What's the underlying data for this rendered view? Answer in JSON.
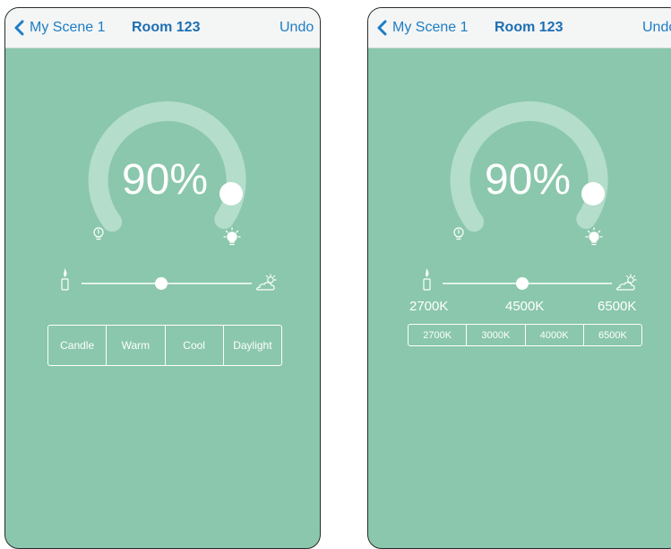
{
  "colors": {
    "background": "#8ac7ac",
    "navbar": "#f4f5f5",
    "nav_blue": "#1d7dc4",
    "arc_track": "#b4ddcc",
    "white": "#ffffff"
  },
  "screen_left": {
    "nav": {
      "back_icon": "chevron-left-icon",
      "back_label": "My Scene 1",
      "title": "Room 123",
      "undo_label": "Undo"
    },
    "dial": {
      "brightness_label": "90%",
      "brightness_value": 0.9,
      "low_icon": "bulb-dim-icon",
      "high_icon": "bulb-bright-icon"
    },
    "temperature_slider": {
      "value_fraction": 0.45,
      "warm_icon": "candle-icon",
      "cool_icon": "sun-cloud-icon"
    },
    "presets": [
      "Candle",
      "Warm",
      "Cool",
      "Daylight"
    ]
  },
  "screen_right": {
    "nav": {
      "back_icon": "chevron-left-icon",
      "back_label": "My Scene 1",
      "title": "Room 123",
      "undo_label": "Undo"
    },
    "dial": {
      "brightness_label": "90%",
      "brightness_value": 0.9,
      "low_icon": "bulb-dim-icon",
      "high_icon": "bulb-bright-icon"
    },
    "temperature_slider": {
      "value_fraction": 0.45,
      "warm_icon": "candle-icon",
      "cool_icon": "sun-cloud-icon"
    },
    "kelvin_labels": {
      "min": "2700K",
      "mid": "4500K",
      "max": "6500K"
    },
    "presets": [
      "2700K",
      "3000K",
      "4000K",
      "6500K"
    ]
  }
}
